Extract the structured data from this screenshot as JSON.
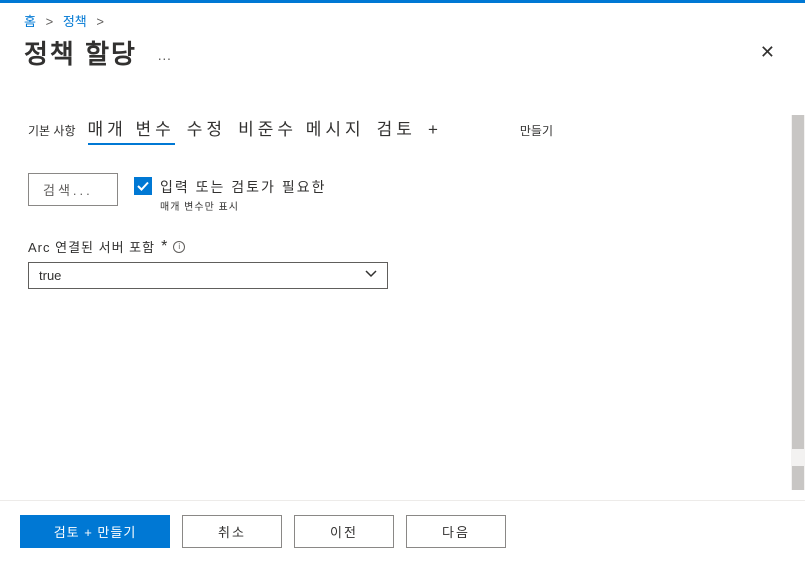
{
  "breadcrumb": {
    "home": "홈",
    "policy": "정책"
  },
  "header": {
    "title": "정책 할당",
    "more": "···"
  },
  "tabs": {
    "basic": "기본 사항",
    "params": "매개 변수",
    "remediation": "수정",
    "noncompliance": "비준수 메시지",
    "review": "검토",
    "plus": "+",
    "create": "만들기"
  },
  "search": {
    "button": "검색..."
  },
  "checkbox": {
    "label": "입력 또는 검토가 필요한",
    "sublabel": "매개 변수만 표시"
  },
  "field": {
    "label": "Arc 연결된 서버 포함",
    "required": "*",
    "value": "true"
  },
  "footer": {
    "review_create": "검토 + 만들기",
    "cancel": "취소",
    "previous": "이전",
    "next": "다음"
  }
}
